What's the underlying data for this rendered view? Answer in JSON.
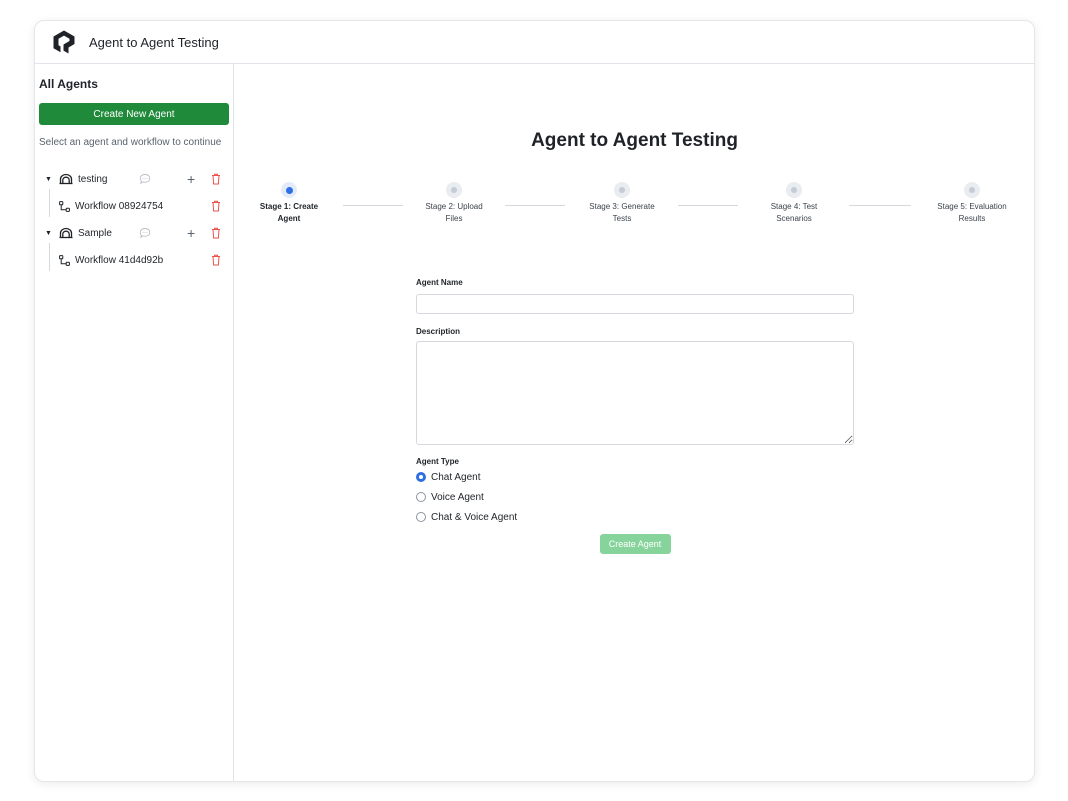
{
  "app": {
    "title": "Agent to Agent Testing",
    "logo_icon": "stylized-arrow-logo-icon"
  },
  "sidebar": {
    "title": "All Agents",
    "create_button_label": "Create New Agent",
    "hint": "Select an agent and workflow to continue",
    "agents": [
      {
        "name": "testing",
        "expanded": true,
        "workflows": [
          {
            "name": "Workflow 08924754"
          }
        ]
      },
      {
        "name": "Sample",
        "expanded": true,
        "workflows": [
          {
            "name": "Workflow 41d4d92b"
          }
        ]
      }
    ]
  },
  "main": {
    "title": "Agent to Agent Testing",
    "steps": [
      {
        "line1": "Stage 1: Create",
        "line2": "Agent",
        "active": true
      },
      {
        "line1": "Stage 2: Upload",
        "line2": "Files",
        "active": false
      },
      {
        "line1": "Stage 3: Generate",
        "line2": "Tests",
        "active": false
      },
      {
        "line1": "Stage 4: Test",
        "line2": "Scenarios",
        "active": false
      },
      {
        "line1": "Stage 5: Evaluation",
        "line2": "Results",
        "active": false
      }
    ],
    "form": {
      "agent_name_label": "Agent Name",
      "agent_name_value": "",
      "description_label": "Description",
      "description_value": "",
      "agent_type_label": "Agent Type",
      "agent_type_options": [
        "Chat Agent",
        "Voice Agent",
        "Chat & Voice Agent"
      ],
      "agent_type_selected": "Chat Agent",
      "submit_label": "Create Agent"
    }
  },
  "colors": {
    "primary_green": "#1f8a3a",
    "disabled_green": "#86d49b",
    "accent_blue": "#2f6fe4",
    "delete_red": "#e5534b"
  }
}
